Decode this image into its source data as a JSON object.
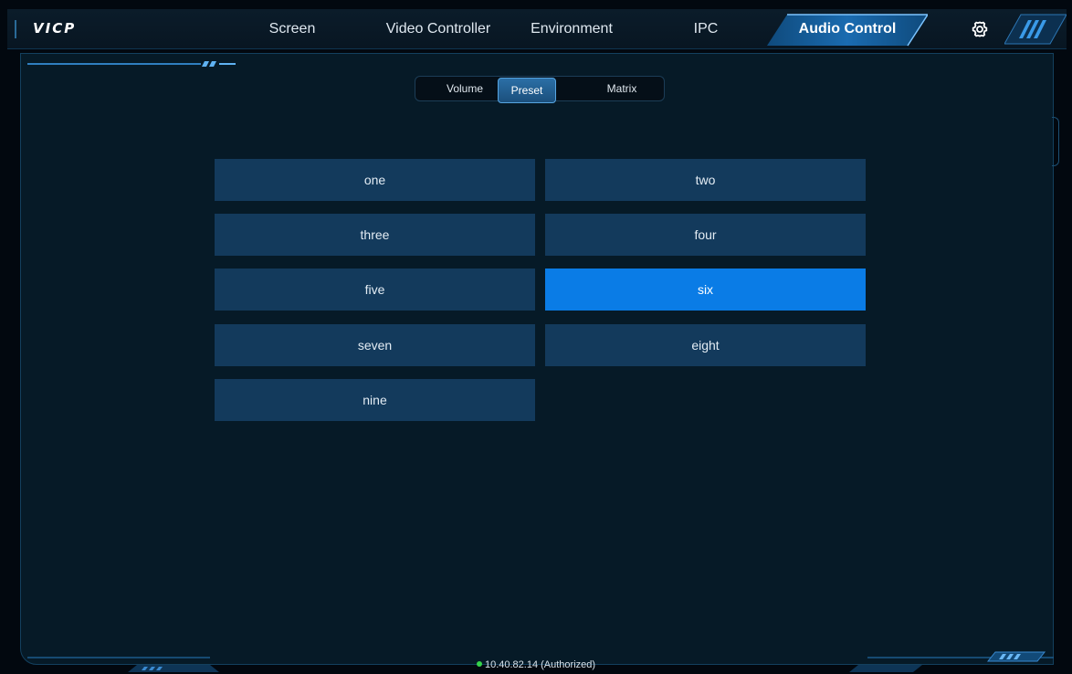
{
  "app": {
    "logo": "VICP"
  },
  "nav": {
    "tabs": [
      {
        "label": "Screen",
        "active": false
      },
      {
        "label": "Video Controller",
        "active": false
      },
      {
        "label": "Environment",
        "active": false
      },
      {
        "label": "IPC",
        "active": false
      },
      {
        "label": "Audio Control",
        "active": true
      }
    ],
    "settings_icon": "gear-icon"
  },
  "audio": {
    "sub_tabs": [
      {
        "label": "Volume",
        "active": false
      },
      {
        "label": "Preset",
        "active": true
      },
      {
        "label": "Matrix",
        "active": false
      }
    ],
    "presets": [
      {
        "label": "one",
        "selected": false
      },
      {
        "label": "two",
        "selected": false
      },
      {
        "label": "three",
        "selected": false
      },
      {
        "label": "four",
        "selected": false
      },
      {
        "label": "five",
        "selected": false
      },
      {
        "label": "six",
        "selected": true
      },
      {
        "label": "seven",
        "selected": false
      },
      {
        "label": "eight",
        "selected": false
      },
      {
        "label": "nine",
        "selected": false
      }
    ]
  },
  "status": {
    "connection": "10.40.82.14 (Authorized)",
    "indicator_color": "#35d24a"
  },
  "colors": {
    "accent": "#0a7ce6",
    "preset_bg": "#133a5c",
    "panel_bg": "#061a27"
  }
}
